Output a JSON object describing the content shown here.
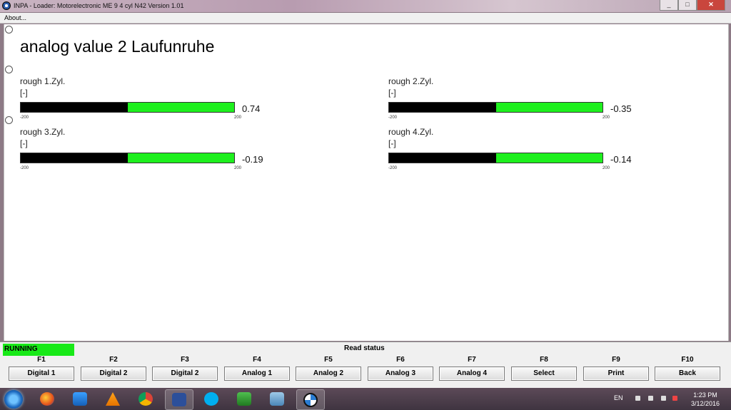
{
  "window": {
    "title": "INPA - Loader:  Motorelectronic ME 9  4 cyl N42 Version 1.01",
    "menu_about": "About..."
  },
  "page": {
    "title": "analog value 2 Laufunruhe"
  },
  "meters": [
    {
      "name": "rough 1.Zyl.",
      "unit": "[-]",
      "value": "0.74",
      "min": "-200",
      "max": "200",
      "fill_fraction": 0.5
    },
    {
      "name": "rough 2.Zyl.",
      "unit": "[-]",
      "value": "-0.35",
      "min": "-200",
      "max": "200",
      "fill_fraction": 0.5
    },
    {
      "name": "rough 3.Zyl.",
      "unit": "[-]",
      "value": "-0.19",
      "min": "-200",
      "max": "200",
      "fill_fraction": 0.5
    },
    {
      "name": "rough 4.Zyl.",
      "unit": "[-]",
      "value": "-0.14",
      "min": "-200",
      "max": "200",
      "fill_fraction": 0.5
    }
  ],
  "status": {
    "state": "RUNNING",
    "message": "Read status",
    "state_color": "#18e918"
  },
  "function_keys": [
    {
      "key": "F1",
      "label": "Digital 1"
    },
    {
      "key": "F2",
      "label": "Digital 2"
    },
    {
      "key": "F3",
      "label": "Digital 2"
    },
    {
      "key": "F4",
      "label": "Analog 1"
    },
    {
      "key": "F5",
      "label": "Analog 2"
    },
    {
      "key": "F6",
      "label": "Analog 3"
    },
    {
      "key": "F7",
      "label": "Analog 4"
    },
    {
      "key": "F8",
      "label": "Select"
    },
    {
      "key": "F9",
      "label": "Print"
    },
    {
      "key": "F10",
      "label": "Back"
    }
  ],
  "taskbar": {
    "apps": [
      "firefox-icon",
      "media-player-icon",
      "vlc-icon",
      "chrome-icon",
      "save-icon",
      "skype-icon",
      "e-app-icon",
      "remote-desktop-icon",
      "bmw-icon"
    ],
    "language": "EN",
    "time": "1:23 PM",
    "date": "3/12/2016"
  },
  "colors": {
    "bar_green": "#1ef01e",
    "bar_black": "#000000"
  }
}
